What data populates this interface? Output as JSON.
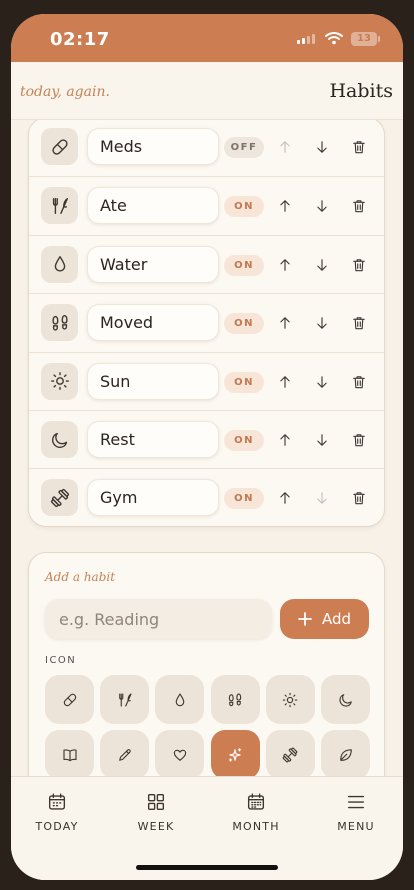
{
  "status": {
    "time": "02:17",
    "battery": "13"
  },
  "header": {
    "tagline": "today, again.",
    "title": "Habits"
  },
  "habits": [
    {
      "name": "Meds",
      "state": "OFF",
      "icon": "pill-icon"
    },
    {
      "name": "Ate",
      "state": "ON",
      "icon": "fork-knife-icon"
    },
    {
      "name": "Water",
      "state": "ON",
      "icon": "droplet-icon"
    },
    {
      "name": "Moved",
      "state": "ON",
      "icon": "footprints-icon"
    },
    {
      "name": "Sun",
      "state": "ON",
      "icon": "sun-icon"
    },
    {
      "name": "Rest",
      "state": "ON",
      "icon": "moon-icon"
    },
    {
      "name": "Gym",
      "state": "ON",
      "icon": "dumbbell-icon"
    }
  ],
  "add": {
    "title": "Add a habit",
    "placeholder": "e.g. Reading",
    "button_label": "Add",
    "icon_label": "ICON",
    "icons": [
      "pill-icon",
      "fork-knife-icon",
      "droplet-icon",
      "footprints-icon",
      "sun-icon",
      "moon-icon",
      "book-icon",
      "pencil-icon",
      "heart-icon",
      "sparkles-icon",
      "dumbbell-icon",
      "leaf-icon"
    ],
    "selected_icon": "sparkles-icon"
  },
  "tabs": [
    {
      "label": "TODAY",
      "icon": "calendar-icon"
    },
    {
      "label": "WEEK",
      "icon": "grid-icon"
    },
    {
      "label": "MONTH",
      "icon": "calendar-month-icon"
    },
    {
      "label": "MENU",
      "icon": "menu-icon"
    }
  ],
  "colors": {
    "accent": "#cc7d52",
    "background": "#f7f1e8",
    "text": "#2b2420"
  }
}
